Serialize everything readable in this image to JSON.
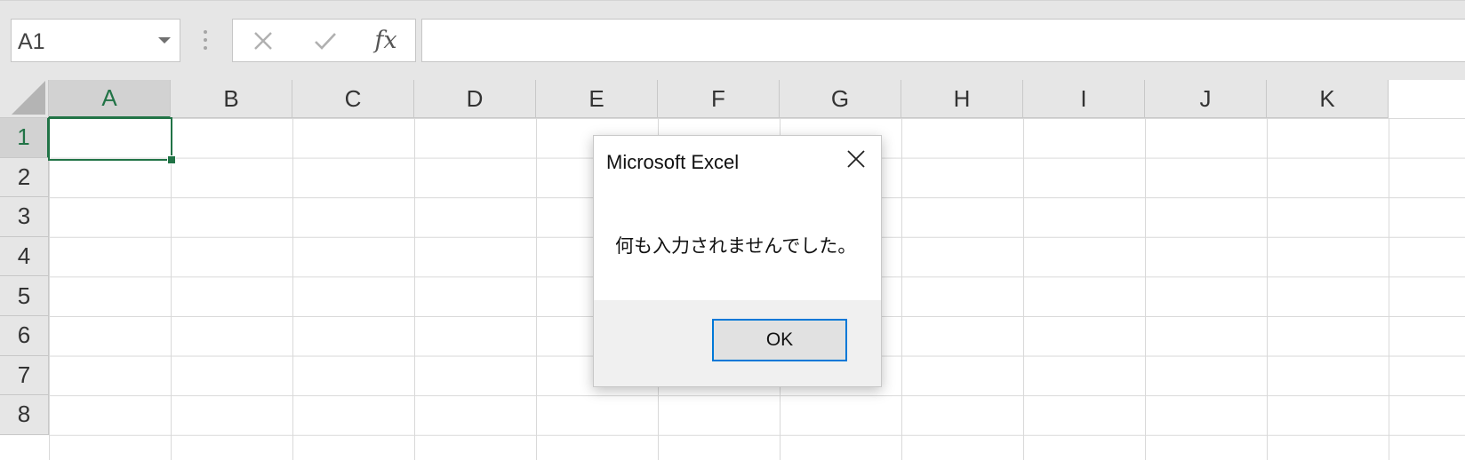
{
  "formula_bar": {
    "name_box_value": "A1",
    "fx_label": "fx",
    "formula_value": ""
  },
  "sheet": {
    "columns": [
      "A",
      "B",
      "C",
      "D",
      "E",
      "F",
      "G",
      "H",
      "I",
      "J",
      "K"
    ],
    "rows": [
      "1",
      "2",
      "3",
      "4",
      "5",
      "6",
      "7",
      "8"
    ],
    "active_column": "A",
    "active_row": "1"
  },
  "dialog": {
    "title": "Microsoft Excel",
    "message": "何も入力されませんでした。",
    "ok_label": "OK"
  },
  "colors": {
    "accent_green": "#217346",
    "focus_blue": "#0078d7"
  }
}
